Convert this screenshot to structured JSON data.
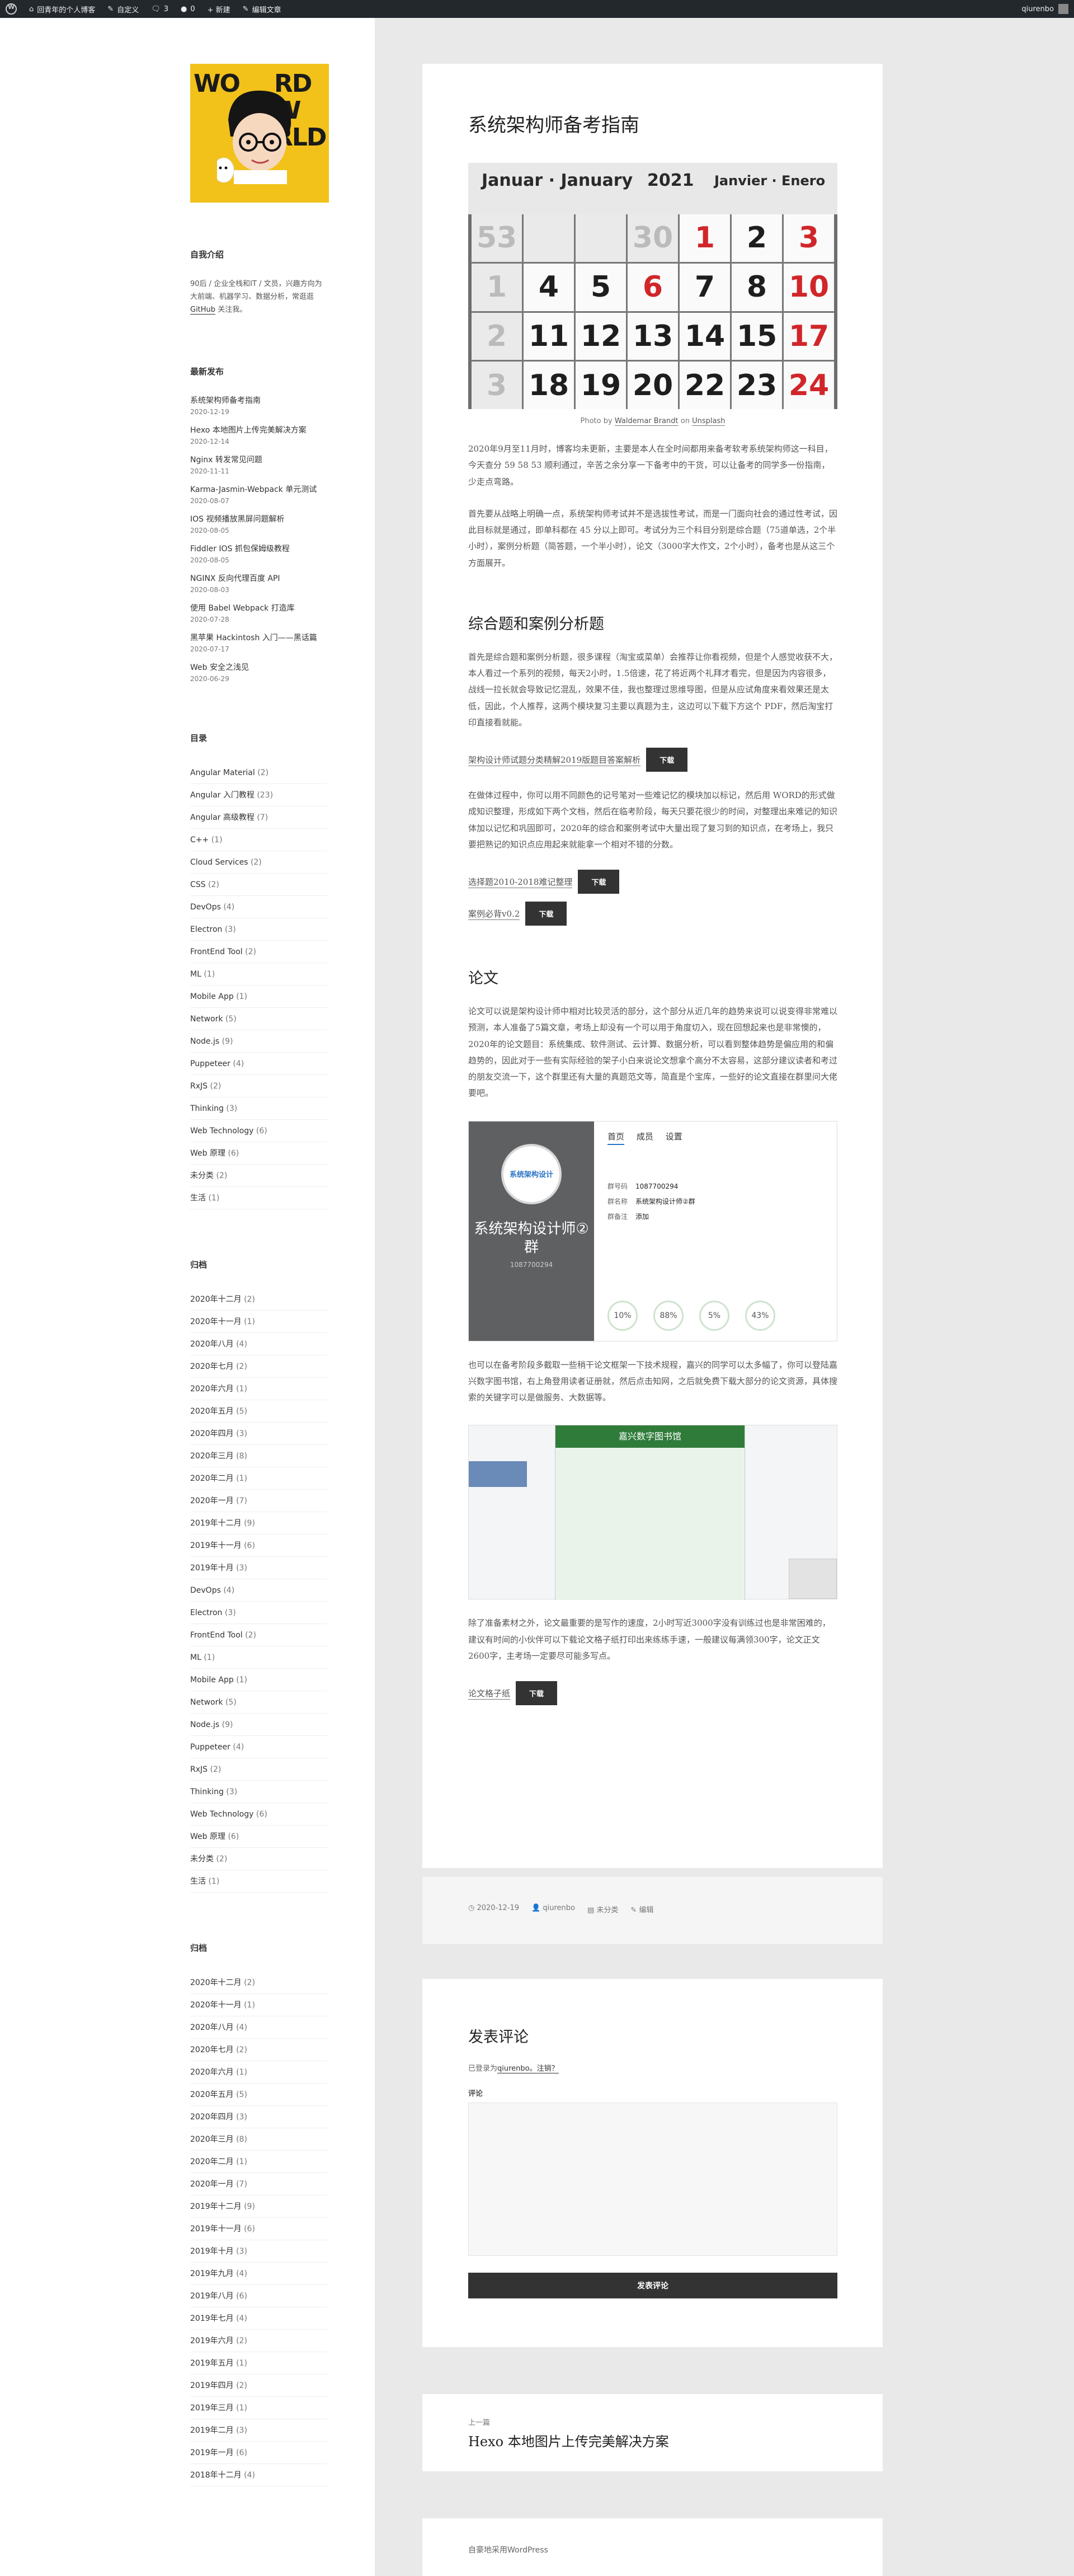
{
  "adminbar": {
    "site_name": "回青年的个人博客",
    "customize": "自定义",
    "comments": "3",
    "updates": "0",
    "new": "+ 新建",
    "edit": "编辑文章",
    "user": "qiurenbo"
  },
  "logo": {
    "lines": [
      "WO",
      "RD",
      "W",
      "RLD"
    ]
  },
  "about": {
    "title": "自我介绍",
    "text_before": "90后 / 企业全栈和IT / 文员，兴趣方向为大前端、机器学习、数据分析，常逛逛",
    "link": "GitHub",
    "text_after": "关注我。"
  },
  "recent": {
    "title": "最新发布",
    "items": [
      {
        "t": "系统架构师备考指南",
        "d": "2020-12-19"
      },
      {
        "t": "Hexo 本地图片上传完美解决方案",
        "d": "2020-12-14"
      },
      {
        "t": "Nginx 转发常见问题",
        "d": "2020-11-11"
      },
      {
        "t": "Karma-Jasmin-Webpack 单元测试",
        "d": "2020-08-07"
      },
      {
        "t": "IOS 视频播放黑屏问题解析",
        "d": "2020-08-05"
      },
      {
        "t": "Fiddler IOS 抓包保姆级教程",
        "d": "2020-08-05"
      },
      {
        "t": "NGINX 反向代理百度 API",
        "d": "2020-08-03"
      },
      {
        "t": "使用 Babel Webpack 打造库",
        "d": "2020-07-28"
      },
      {
        "t": "黑苹果 Hackintosh 入门——黑话篇",
        "d": "2020-07-17"
      },
      {
        "t": "Web 安全之浅见",
        "d": "2020-06-29"
      }
    ]
  },
  "categories": {
    "title": "目录",
    "items": [
      {
        "n": "Angular Material",
        "c": "(2)"
      },
      {
        "n": "Angular 入门教程",
        "c": "(23)"
      },
      {
        "n": "Angular 高级教程",
        "c": "(7)"
      },
      {
        "n": "C++",
        "c": "(1)"
      },
      {
        "n": "Cloud Services",
        "c": "(2)"
      },
      {
        "n": "CSS",
        "c": "(2)"
      },
      {
        "n": "DevOps",
        "c": "(4)"
      },
      {
        "n": "Electron",
        "c": "(3)"
      },
      {
        "n": "FrontEnd Tool",
        "c": "(2)"
      },
      {
        "n": "ML",
        "c": "(1)"
      },
      {
        "n": "Mobile App",
        "c": "(1)"
      },
      {
        "n": "Network",
        "c": "(5)"
      },
      {
        "n": "Node.js",
        "c": "(9)"
      },
      {
        "n": "Puppeteer",
        "c": "(4)"
      },
      {
        "n": "RxJS",
        "c": "(2)"
      },
      {
        "n": "Thinking",
        "c": "(3)"
      },
      {
        "n": "Web Technology",
        "c": "(6)"
      },
      {
        "n": "Web 原理",
        "c": "(6)"
      },
      {
        "n": "未分类",
        "c": "(2)"
      },
      {
        "n": "生活",
        "c": "(1)"
      }
    ]
  },
  "archives1": {
    "title": "归档",
    "items": [
      {
        "n": "2020年十二月",
        "c": "(2)"
      },
      {
        "n": "2020年十一月",
        "c": "(1)"
      },
      {
        "n": "2020年八月",
        "c": "(4)"
      },
      {
        "n": "2020年七月",
        "c": "(2)"
      },
      {
        "n": "2020年六月",
        "c": "(1)"
      },
      {
        "n": "2020年五月",
        "c": "(5)"
      },
      {
        "n": "2020年四月",
        "c": "(3)"
      },
      {
        "n": "2020年三月",
        "c": "(8)"
      },
      {
        "n": "2020年二月",
        "c": "(1)"
      },
      {
        "n": "2020年一月",
        "c": "(7)"
      },
      {
        "n": "2019年十二月",
        "c": "(9)"
      },
      {
        "n": "2019年十一月",
        "c": "(6)"
      },
      {
        "n": "2019年十月",
        "c": "(3)"
      }
    ],
    "extra": [
      {
        "n": "DevOps",
        "c": "(4)"
      },
      {
        "n": "Electron",
        "c": "(3)"
      },
      {
        "n": "FrontEnd Tool",
        "c": "(2)"
      },
      {
        "n": "ML",
        "c": "(1)"
      },
      {
        "n": "Mobile App",
        "c": "(1)"
      },
      {
        "n": "Network",
        "c": "(5)"
      },
      {
        "n": "Node.js",
        "c": "(9)"
      },
      {
        "n": "Puppeteer",
        "c": "(4)"
      },
      {
        "n": "RxJS",
        "c": "(2)"
      },
      {
        "n": "Thinking",
        "c": "(3)"
      },
      {
        "n": "Web Technology",
        "c": "(6)"
      },
      {
        "n": "Web 原理",
        "c": "(6)"
      },
      {
        "n": "未分类",
        "c": "(2)"
      },
      {
        "n": "生活",
        "c": "(1)"
      }
    ]
  },
  "archives2": {
    "title": "归档",
    "items": [
      {
        "n": "2020年十二月",
        "c": "(2)"
      },
      {
        "n": "2020年十一月",
        "c": "(1)"
      },
      {
        "n": "2020年八月",
        "c": "(4)"
      },
      {
        "n": "2020年七月",
        "c": "(2)"
      },
      {
        "n": "2020年六月",
        "c": "(1)"
      },
      {
        "n": "2020年五月",
        "c": "(5)"
      },
      {
        "n": "2020年四月",
        "c": "(3)"
      },
      {
        "n": "2020年三月",
        "c": "(8)"
      },
      {
        "n": "2020年二月",
        "c": "(1)"
      },
      {
        "n": "2020年一月",
        "c": "(7)"
      },
      {
        "n": "2019年十二月",
        "c": "(9)"
      },
      {
        "n": "2019年十一月",
        "c": "(6)"
      },
      {
        "n": "2019年十月",
        "c": "(3)"
      },
      {
        "n": "2019年九月",
        "c": "(4)"
      },
      {
        "n": "2019年八月",
        "c": "(6)"
      },
      {
        "n": "2019年七月",
        "c": "(4)"
      },
      {
        "n": "2019年六月",
        "c": "(2)"
      },
      {
        "n": "2019年五月",
        "c": "(1)"
      },
      {
        "n": "2019年四月",
        "c": "(2)"
      },
      {
        "n": "2019年三月",
        "c": "(1)"
      },
      {
        "n": "2019年二月",
        "c": "(3)"
      },
      {
        "n": "2019年一月",
        "c": "(6)"
      },
      {
        "n": "2018年十二月",
        "c": "(4)"
      }
    ]
  },
  "article": {
    "title": "系统架构师备考指南",
    "calendar": {
      "month_de": "Januar · January",
      "year": "2021",
      "month_fr": "Janvier · Enero",
      "days": [
        {
          "v": "53",
          "k": "grey"
        },
        {
          "v": "",
          "k": "grey"
        },
        {
          "v": "",
          "k": "grey"
        },
        {
          "v": "30",
          "k": "grey"
        },
        {
          "v": "1",
          "k": "red"
        },
        {
          "v": "2",
          "k": ""
        },
        {
          "v": "3",
          "k": "red"
        },
        {
          "v": "1",
          "k": "grey"
        },
        {
          "v": "4",
          "k": ""
        },
        {
          "v": "5",
          "k": ""
        },
        {
          "v": "6",
          "k": "red"
        },
        {
          "v": "7",
          "k": ""
        },
        {
          "v": "8",
          "k": ""
        },
        {
          "v": "10",
          "k": "red"
        },
        {
          "v": "2",
          "k": "grey"
        },
        {
          "v": "11",
          "k": ""
        },
        {
          "v": "12",
          "k": ""
        },
        {
          "v": "13",
          "k": ""
        },
        {
          "v": "14",
          "k": ""
        },
        {
          "v": "15",
          "k": ""
        },
        {
          "v": "17",
          "k": "red"
        },
        {
          "v": "3",
          "k": "grey"
        },
        {
          "v": "18",
          "k": ""
        },
        {
          "v": "19",
          "k": ""
        },
        {
          "v": "20",
          "k": ""
        },
        {
          "v": "22",
          "k": ""
        },
        {
          "v": "23",
          "k": ""
        },
        {
          "v": "24",
          "k": "red"
        }
      ]
    },
    "caption_pre": "Photo by",
    "caption_author": "Waldemar Brandt",
    "caption_mid": "on",
    "caption_site": "Unsplash",
    "p1": "2020年9月至11月时，博客均未更新，主要是本人在全时间都用来备考软考系统架构师这一科目，今天查分 59 58 53 顺利通过，辛苦之余分享一下备考中的干货，可以让备考的同学多一份指南，少走点弯路。",
    "p2": "首先要从战略上明确一点，系统架构师考试并不是选拔性考试，而是一门面向社会的通过性考试，因此目标就是通过，即单科都在 45 分以上即可。考试分为三个科目分别是综合题（75道单选，2个半小时），案例分析题（简答题，一个半小时），论文（3000字大作文，2个小时），备考也是从这三个方面展开。",
    "h_case": "综合题和案例分析题",
    "p3": "首先是综合题和案例分析题，很多课程（淘宝或菜单）会推荐让你看视频，但是个人感觉收获不大，本人看过一个系列的视频，每天2小时，1.5倍速，花了将近两个礼拜才看完，但是因为内容很多，战线一拉长就会导致记忆混乱，效果不佳，我也整理过思维导图，但是从应试角度来看效果还是太低，因此，个人推荐，这两个模块复习主要以真题为主，这边可以下载下方这个 PDF，然后淘宝打印直接看就能。",
    "dl1_text": "架构设计师试题分类精解2019版题目答案解析",
    "dl_btn": "下载",
    "p4": "在做体过程中，你可以用不同颜色的记号笔对一些难记忆的模块加以标记，然后用 WORD的形式做成知识整理，形成如下两个文档，然后在临考阶段，每天只要花很少的时间，对整理出来难记的知识体加以记忆和巩固即可，2020年的综合和案例考试中大量出现了复习到的知识点，在考场上，我只要把熟记的知识点应用起来就能拿一个相对不错的分数。",
    "dl2_text": "选择题2010-2018难记整理",
    "dl3_text": "案例必背v0.2",
    "h_essay": "论文",
    "p5": "论文可以说是架构设计师中相对比较灵活的部分，这个部分从近几年的趋势来说可以说变得非常难以预测，本人准备了5篇文章，考场上却没有一个可以用于角度切入，现在回想起来也是非常懊的，2020年的论文题目：系统集成、软件测试、云计算、数据分析，可以看到整体趋势是偏应用的和偏趋势的，因此对于一些有实际经验的架子小白来说论文想拿个高分不太容易，这部分建议读者和考过的朋友交流一下，这个群里还有大量的真题范文等，简直是个宝库，一些好的论文直接在群里问大佬要吧。",
    "shot": {
      "group": "系统架构设计师②群",
      "group_no": "1087700294",
      "tabs": [
        "首页",
        "成员",
        "设置"
      ],
      "line1_k": "群号码",
      "line1_v": "1087700294",
      "line2_k": "群名称",
      "line2_v": "系统架构设计师②群",
      "line3_k": "群备注",
      "line3_v": "添加",
      "stats": [
        "10%",
        "88%",
        "5%",
        "43%"
      ],
      "badge": "系统架构设计"
    },
    "p6": "也可以在备考阶段多截取一些稍干论文框架一下技术规程，嘉兴的同学可以太多幅了，你可以登陆嘉兴数字图书馆，右上角登用读者证册就，然后点击知网，之后就免费下载大部分的论文资源，具体搜索的关键字可以是做服务、大数据等。",
    "lib_banner": "嘉兴数字图书馆",
    "p7": "除了准备素材之外，论文最重要的是写作的速度，2小时写近3000字没有训练过也是非常困难的，建议有时间的小伙伴可以下载论文格子纸打印出来练练手速，一般建议每满领300字，论文正文2600字，主考场一定要尽可能多写点。",
    "dl4_text": "论文格子纸",
    "footer_date": "2020-12-19",
    "footer_author": "qiurenbo",
    "footer_cat": "未分类",
    "footer_edit": "编辑"
  },
  "comments": {
    "title": "发表评论",
    "logged_pre": "已登录为",
    "logged_user": "qiurenbo",
    "logged_post": "。注销？",
    "label": "评论",
    "submit": "发表评论"
  },
  "nav": {
    "label": "上一篇",
    "title": "Hexo 本地图片上传完美解决方案"
  },
  "footer": {
    "text": "自豪地采用WordPress"
  }
}
